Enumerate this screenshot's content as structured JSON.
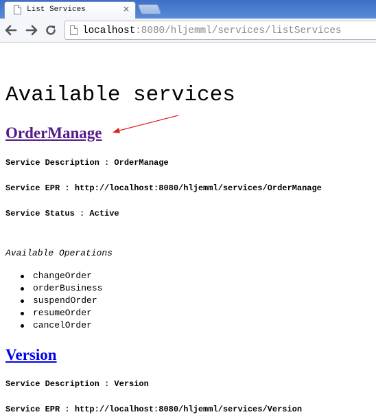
{
  "browser": {
    "tab_title": "List Services",
    "tab_close": "×",
    "url_host": "localhost",
    "url_rest": ":8080/hljemml/services/listServices"
  },
  "page": {
    "title": "Available services",
    "operations_heading": "Available Operations"
  },
  "services": [
    {
      "name": "OrderManage",
      "description": "Service Description : OrderManage",
      "epr": "Service EPR : http://localhost:8080/hljemml/services/OrderManage",
      "status": "Service Status : Active",
      "operations": [
        "changeOrder",
        "orderBusiness",
        "suspendOrder",
        "resumeOrder",
        "cancelOrder"
      ]
    },
    {
      "name": "Version",
      "description": "Service Description : Version",
      "epr": "Service EPR : http://localhost:8080/hljemml/services/Version"
    }
  ],
  "colors": {
    "visited_link": "#551a8b",
    "unvisited_link": "#0000ee",
    "annotation_arrow": "#e02020",
    "tabstrip": "#4a7bd0"
  },
  "icons": {
    "tab": "page-icon",
    "back": "back-arrow-icon",
    "forward": "forward-arrow-icon",
    "reload": "reload-icon"
  }
}
